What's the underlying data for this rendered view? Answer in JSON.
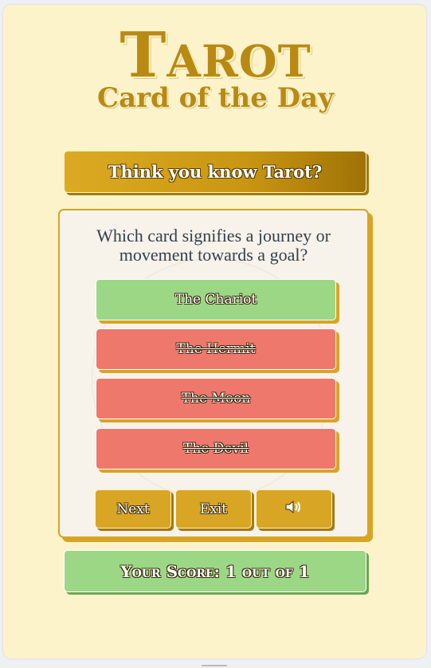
{
  "logo": {
    "title": "Tarot",
    "subtitle": "Card of the Day"
  },
  "banner": {
    "text": "Think you know Tarot?"
  },
  "quiz": {
    "question": "Which card signifies a journey or movement towards a goal?",
    "answers": [
      {
        "label": "The Chariot",
        "state": "correct"
      },
      {
        "label": "The Hermit",
        "state": "wrong"
      },
      {
        "label": "The Moon",
        "state": "wrong"
      },
      {
        "label": "The Devil",
        "state": "wrong"
      }
    ],
    "controls": {
      "next_label": "Next",
      "exit_label": "Exit",
      "sound_icon": "speaker-volume-icon"
    }
  },
  "score": {
    "text": "Your Score: 1 out of 1"
  },
  "colors": {
    "background": "#fdf3cb",
    "gold": "#d9a524",
    "correct": "#9cd785",
    "wrong": "#ef786d",
    "panel": "#f7f2ea"
  }
}
